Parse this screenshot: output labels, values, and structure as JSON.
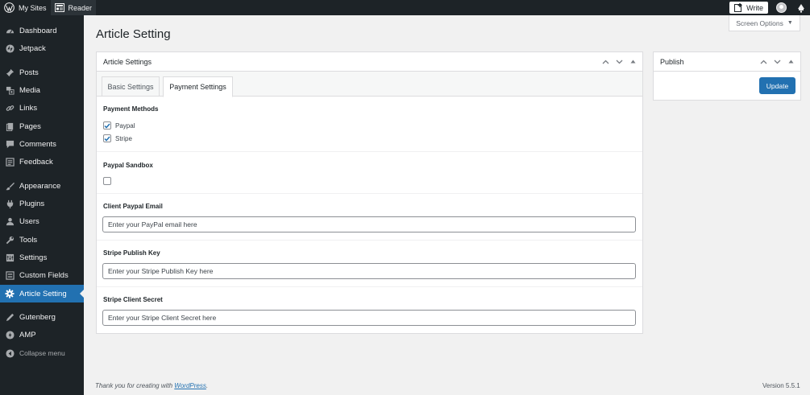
{
  "adminbar": {
    "my_sites": "My Sites",
    "reader": "Reader",
    "write": "Write"
  },
  "sidebar": {
    "items": [
      {
        "label": "Dashboard",
        "icon": "dashboard-icon"
      },
      {
        "label": "Jetpack",
        "icon": "jetpack-icon"
      },
      {
        "label": "Posts",
        "icon": "pin-icon"
      },
      {
        "label": "Media",
        "icon": "media-icon"
      },
      {
        "label": "Links",
        "icon": "link-icon"
      },
      {
        "label": "Pages",
        "icon": "pages-icon"
      },
      {
        "label": "Comments",
        "icon": "comment-icon"
      },
      {
        "label": "Feedback",
        "icon": "feedback-icon"
      },
      {
        "label": "Appearance",
        "icon": "brush-icon"
      },
      {
        "label": "Plugins",
        "icon": "plugin-icon"
      },
      {
        "label": "Users",
        "icon": "users-icon"
      },
      {
        "label": "Tools",
        "icon": "wrench-icon"
      },
      {
        "label": "Settings",
        "icon": "sliders-icon"
      },
      {
        "label": "Custom Fields",
        "icon": "fields-icon"
      },
      {
        "label": "Article Setting",
        "icon": "gear-icon",
        "current": true
      },
      {
        "label": "Gutenberg",
        "icon": "pencil-icon"
      },
      {
        "label": "AMP",
        "icon": "amp-icon"
      }
    ],
    "collapse": "Collapse menu"
  },
  "page": {
    "title": "Article Setting",
    "screen_options": "Screen Options"
  },
  "settings_box": {
    "title": "Article Settings",
    "tabs": [
      "Basic Settings",
      "Payment Settings"
    ],
    "active_tab": "Payment Settings",
    "payment_methods": {
      "label": "Payment Methods",
      "options": [
        {
          "label": "Paypal",
          "checked": true
        },
        {
          "label": "Stripe",
          "checked": true
        }
      ]
    },
    "paypal_sandbox": {
      "label": "Paypal Sandbox",
      "checked": false
    },
    "client_paypal_email": {
      "label": "Client Paypal Email",
      "placeholder": "Enter your PayPal email here"
    },
    "stripe_publish_key": {
      "label": "Stripe Publish Key",
      "placeholder": "Enter your Stripe Publish Key here"
    },
    "stripe_client_secret": {
      "label": "Stripe Client Secret",
      "placeholder": "Enter your Stripe Client Secret here"
    }
  },
  "publish_box": {
    "title": "Publish",
    "update": "Update"
  },
  "footer": {
    "thanks": "Thank you for creating with ",
    "link": "WordPress",
    "period": ".",
    "version": "Version 5.5.1"
  },
  "colors": {
    "accent": "#2271b1",
    "sidebar_bg": "#1d2327",
    "page_bg": "#f1f1f1"
  }
}
